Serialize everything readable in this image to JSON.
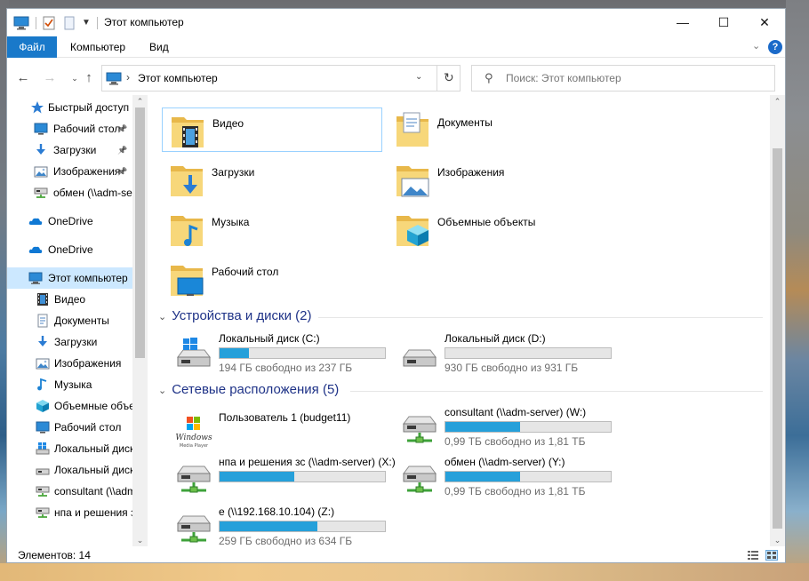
{
  "window": {
    "title": "Этот компьютер",
    "minimize": "—",
    "maximize": "☐",
    "close": "✕"
  },
  "ribbon": {
    "tabs": [
      "Файл",
      "Компьютер",
      "Вид"
    ],
    "help": "?"
  },
  "address": {
    "path": "Этот компьютер",
    "separator": "›"
  },
  "search": {
    "placeholder": "Поиск: Этот компьютер"
  },
  "nav": {
    "items": [
      {
        "label": "Быстрый доступ",
        "icon": "star-icon",
        "pinned": false
      },
      {
        "label": "Рабочий стол",
        "icon": "desktop-icon",
        "pinned": true
      },
      {
        "label": "Загрузки",
        "icon": "downloads-icon",
        "pinned": true
      },
      {
        "label": "Изображения",
        "icon": "pictures-icon",
        "pinned": true
      },
      {
        "label": "обмен (\\\\adm-server) (Y:)",
        "icon": "network-drive-icon",
        "pinned": false
      },
      {
        "label": "OneDrive",
        "icon": "onedrive-icon",
        "pinned": false
      },
      {
        "label": "OneDrive",
        "icon": "onedrive-icon",
        "pinned": false
      },
      {
        "label": "Этот компьютер",
        "icon": "computer-icon",
        "pinned": false,
        "selected": true
      },
      {
        "label": "Видео",
        "icon": "video-icon",
        "pinned": false
      },
      {
        "label": "Документы",
        "icon": "documents-icon",
        "pinned": false
      },
      {
        "label": "Загрузки",
        "icon": "downloads-icon",
        "pinned": false
      },
      {
        "label": "Изображения",
        "icon": "pictures-icon",
        "pinned": false
      },
      {
        "label": "Музыка",
        "icon": "music-icon",
        "pinned": false
      },
      {
        "label": "Объемные объекты",
        "icon": "3d-objects-icon",
        "pinned": false
      },
      {
        "label": "Рабочий стол",
        "icon": "desktop-icon",
        "pinned": false
      },
      {
        "label": "Локальный диск (C:)",
        "icon": "windows-drive-icon",
        "pinned": false
      },
      {
        "label": "Локальный диск (D:)",
        "icon": "drive-icon",
        "pinned": false
      },
      {
        "label": "consultant (\\\\adm-server) (W:)",
        "icon": "network-drive-icon",
        "pinned": false
      },
      {
        "label": "нпа и решения зс (\\\\adm-server) (X:)",
        "icon": "network-drive-icon",
        "pinned": false
      }
    ]
  },
  "folders": [
    {
      "label": "Видео",
      "icon": "video-folder-icon"
    },
    {
      "label": "Документы",
      "icon": "documents-folder-icon"
    },
    {
      "label": "Загрузки",
      "icon": "downloads-folder-icon"
    },
    {
      "label": "Изображения",
      "icon": "pictures-folder-icon"
    },
    {
      "label": "Музыка",
      "icon": "music-folder-icon"
    },
    {
      "label": "Объемные объекты",
      "icon": "3d-objects-folder-icon"
    },
    {
      "label": "Рабочий стол",
      "icon": "desktop-folder-icon"
    }
  ],
  "groups": {
    "devices": "Устройства и диски (2)",
    "network": "Сетевые расположения (5)"
  },
  "devices": [
    {
      "label": "Локальный диск (C:)",
      "free": "194 ГБ свободно из 237 ГБ",
      "used_fraction": 0.18,
      "icon": "windows-drive-icon"
    },
    {
      "label": "Локальный диск (D:)",
      "free": "930 ГБ свободно из 931 ГБ",
      "used_fraction": 0.0,
      "icon": "drive-icon"
    }
  ],
  "network": [
    {
      "label": "Пользователь 1 (budget11)",
      "free": "",
      "used_fraction": null,
      "icon": "windows-media-player-icon",
      "logo_text": "Windows",
      "logo_sub": "Media Player"
    },
    {
      "label": "consultant (\\\\adm-server) (W:)",
      "free": "0,99 ТБ свободно из 1,81 ТБ",
      "used_fraction": 0.45,
      "icon": "network-drive-icon"
    },
    {
      "label": "нпа и решения зс (\\\\adm-server) (X:)",
      "free": "",
      "used_fraction": 0.45,
      "icon": "network-drive-icon"
    },
    {
      "label": "обмен (\\\\adm-server) (Y:)",
      "free": "0,99 ТБ свободно из 1,81 ТБ",
      "used_fraction": 0.45,
      "icon": "network-drive-icon"
    },
    {
      "label": "e (\\\\192.168.10.104) (Z:)",
      "free": "259 ГБ свободно из 634 ГБ",
      "used_fraction": 0.59,
      "icon": "network-drive-icon"
    }
  ],
  "status": {
    "count": "Элементов: 14"
  },
  "colors": {
    "accent": "#1979ca",
    "bar": "#26a0da",
    "group": "#1e3287",
    "selection": "#cce8ff"
  }
}
